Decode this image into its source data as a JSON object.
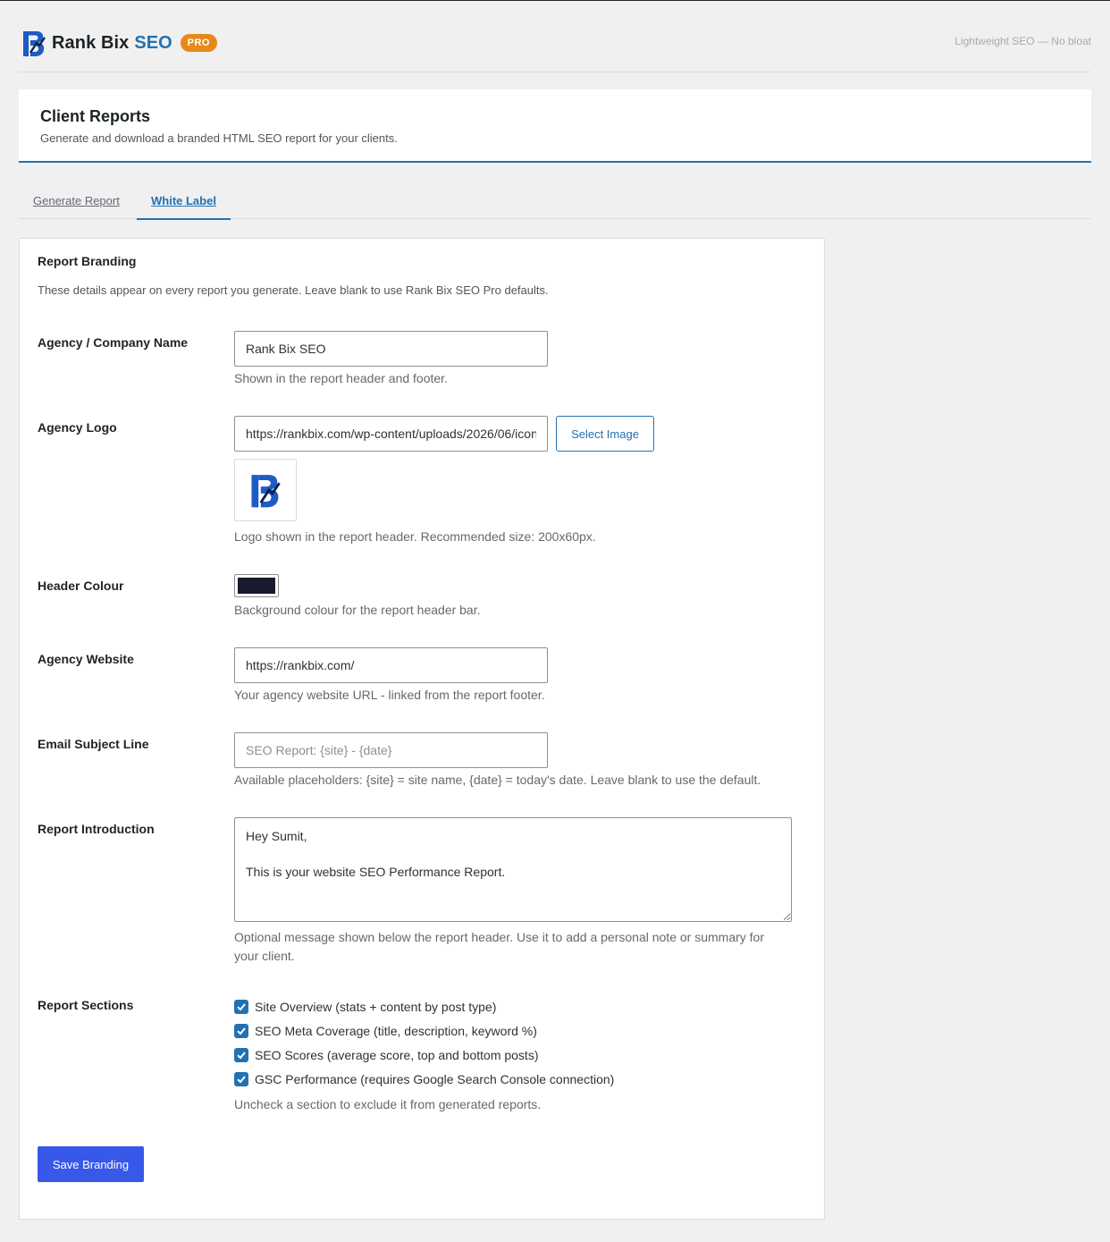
{
  "brand": {
    "name": "Rank Bix",
    "name_accent": "SEO",
    "badge": "PRO",
    "tagline": "Lightweight SEO — No bloat",
    "logo_icon": "rank-bix-logo-icon",
    "accent_color": "#2271b1",
    "badge_color": "#e58a1a"
  },
  "header": {
    "title": "Client Reports",
    "description": "Generate and download a branded HTML SEO report for your clients."
  },
  "tabs": [
    {
      "label": "Generate Report",
      "active": false
    },
    {
      "label": "White Label",
      "active": true
    }
  ],
  "branding": {
    "title": "Report Branding",
    "description": "These details appear on every report you generate. Leave blank to use Rank Bix SEO Pro defaults.",
    "agency_name": {
      "label": "Agency / Company Name",
      "value": "Rank Bix SEO",
      "help": "Shown in the report header and footer."
    },
    "agency_logo": {
      "label": "Agency Logo",
      "value": "https://rankbix.com/wp-content/uploads/2026/06/icon.png",
      "button": "Select Image",
      "help": "Logo shown in the report header. Recommended size: 200x60px."
    },
    "header_colour": {
      "label": "Header Colour",
      "value": "#1a1a2e",
      "help": "Background colour for the report header bar."
    },
    "agency_website": {
      "label": "Agency Website",
      "value": "https://rankbix.com/",
      "help": "Your agency website URL - linked from the report footer."
    },
    "email_subject": {
      "label": "Email Subject Line",
      "value": "",
      "placeholder": "SEO Report: {site} - {date}",
      "help": "Available placeholders: {site} = site name, {date} = today's date. Leave blank to use the default."
    },
    "report_intro": {
      "label": "Report Introduction",
      "value": "Hey Sumit,\n\nThis is your website SEO Performance Report.",
      "help": "Optional message shown below the report header. Use it to add a personal note or summary for your client."
    },
    "report_sections": {
      "label": "Report Sections",
      "items": [
        {
          "label": "Site Overview (stats + content by post type)",
          "checked": true
        },
        {
          "label": "SEO Meta Coverage (title, description, keyword %)",
          "checked": true
        },
        {
          "label": "SEO Scores (average score, top and bottom posts)",
          "checked": true
        },
        {
          "label": "GSC Performance (requires Google Search Console connection)",
          "checked": true
        }
      ],
      "help": "Uncheck a section to exclude it from generated reports."
    },
    "save_button": "Save Branding"
  }
}
